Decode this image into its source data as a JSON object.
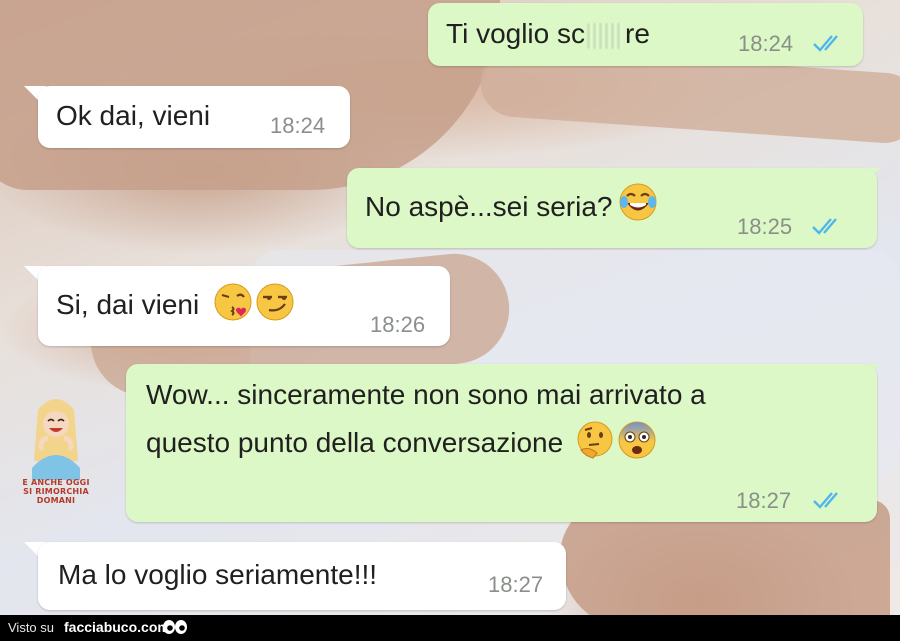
{
  "messages": [
    {
      "direction": "out",
      "text_before": "Ti voglio sc",
      "text_after": "re",
      "time": "18:24",
      "read": true
    },
    {
      "direction": "in",
      "text": "Ok dai, vieni",
      "time": "18:24"
    },
    {
      "direction": "out",
      "text": "No aspè...sei seria?",
      "emoji": [
        "tears-of-joy"
      ],
      "time": "18:25",
      "read": true
    },
    {
      "direction": "in",
      "text": "Si, dai vieni",
      "emoji": [
        "kissing-heart",
        "smirking"
      ],
      "time": "18:26"
    },
    {
      "direction": "out",
      "text_line1": "Wow... sinceramente non sono mai arrivato a",
      "text_line2": "questo punto della conversazione",
      "emoji": [
        "thinking",
        "fearful"
      ],
      "time": "18:27",
      "read": true
    },
    {
      "direction": "in",
      "text": "Ma lo voglio seriamente!!!",
      "time": "18:27"
    }
  ],
  "watermark": {
    "line1": "E ANCHE OGGI",
    "line2": "SI RIMORCHIA DOMANI"
  },
  "footer": {
    "visto_su": "Visto su",
    "site": "facciabuco.com"
  },
  "colors": {
    "incoming_bubble": "#ffffff",
    "outgoing_bubble": "#dcf8c6",
    "read_ticks": "#4fb6ec",
    "timestamp": "#8a8f8a",
    "footer_bg": "#000000"
  }
}
